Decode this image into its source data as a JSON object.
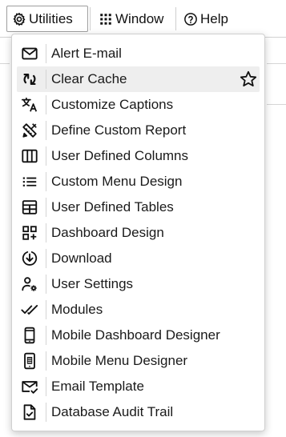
{
  "menubar": {
    "items": [
      {
        "label": "Utilities",
        "icon": "gear-icon"
      },
      {
        "label": "Window",
        "icon": "grid-dots-icon"
      },
      {
        "label": "Help",
        "icon": "help-circle-icon"
      }
    ]
  },
  "dropdown": {
    "items": [
      {
        "label": "Alert E-mail",
        "icon": "envelope-icon"
      },
      {
        "label": "Clear Cache",
        "icon": "refresh-icon"
      },
      {
        "label": "Customize Captions",
        "icon": "translate-icon"
      },
      {
        "label": "Define Custom Report",
        "icon": "ruler-pencil-icon"
      },
      {
        "label": "User Defined Columns",
        "icon": "columns-icon"
      },
      {
        "label": "Custom Menu Design",
        "icon": "list-icon"
      },
      {
        "label": "User Defined Tables",
        "icon": "table-icon"
      },
      {
        "label": "Dashboard Design",
        "icon": "dashboard-add-icon"
      },
      {
        "label": "Download",
        "icon": "download-circle-icon"
      },
      {
        "label": "User Settings",
        "icon": "user-gear-icon"
      },
      {
        "label": "Modules",
        "icon": "double-check-icon"
      },
      {
        "label": "Mobile Dashboard Designer",
        "icon": "mobile-phone-icon"
      },
      {
        "label": "Mobile Menu Designer",
        "icon": "mobile-menu-icon"
      },
      {
        "label": "Email Template",
        "icon": "email-check-icon"
      },
      {
        "label": "Database Audit Trail",
        "icon": "file-check-icon"
      }
    ],
    "hovered_item": "Clear Cache",
    "hover_action_icon": "star-outline-icon"
  },
  "colors": {
    "hover_bg": "#eeeeee",
    "text": "#1a1a1a",
    "border": "#d0d0d0"
  }
}
